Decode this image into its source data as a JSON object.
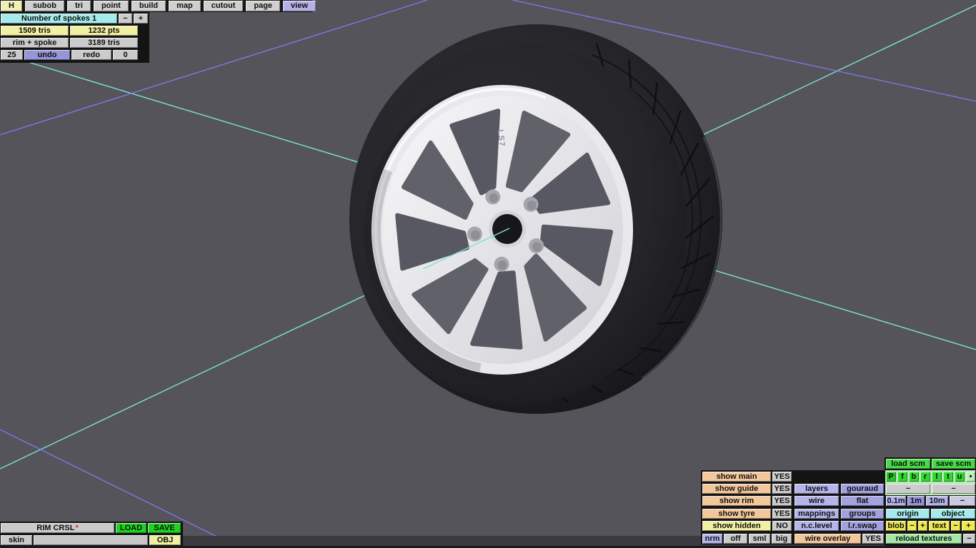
{
  "tabs": [
    "H",
    "subob",
    "tri",
    "point",
    "build",
    "map",
    "cutout",
    "page",
    "view"
  ],
  "top_panel": {
    "spokes": "Number of spokes 1",
    "minus": "−",
    "plus": "+",
    "tris": "1509 tris",
    "pts": "1232 pts",
    "rim_spoke": "rim + spoke",
    "total_tris": "3189 tris",
    "undo_count": "25",
    "undo": "undo",
    "redo": "redo",
    "redo_count": "0"
  },
  "bottom_left": {
    "rim_crsl": "RIM CRSL",
    "star": "*",
    "load": "LOAD",
    "save": "SAVE",
    "skin": "skin",
    "field": "",
    "obj": "OBJ"
  },
  "br": {
    "load_scm": "load scm",
    "save_scm": "save scm",
    "p": "P",
    "f": "f",
    "b": "b",
    "r": "r",
    "l": "l",
    "t": "t",
    "u": "u",
    "dot": "•",
    "dash": "−",
    "plus": "+",
    "show_main": "show main",
    "show_guide": "show guide",
    "show_rim": "show rim",
    "show_tyre": "show tyre",
    "show_hidden": "show hidden",
    "yes": "YES",
    "no": "NO",
    "layers": "layers",
    "gouraud": "gouraud",
    "wire": "wire",
    "flat": "flat",
    "mappings": "mappings",
    "groups": "groups",
    "nclevel": "n.c.level",
    "lrswap": "l.r.swap",
    "m01": "0.1m",
    "m1": "1m",
    "m10": "10m",
    "origin": "origin",
    "object": "object",
    "blob": "blob",
    "text": "text",
    "nrm": "nrm",
    "off": "off",
    "sml": "sml",
    "big": "big",
    "wire_overlay": "wire overlay",
    "reload": "reload textures"
  },
  "wheel": {
    "logo": "LS7"
  },
  "colors": {
    "viewport_bg": "#54545a",
    "guide_cyan": "#7ce0d8",
    "guide_purple": "#7a7ae4",
    "button_green": "#1ed41e",
    "accent_lavender": "#b5b5ec",
    "accent_peach": "#f2c79c",
    "accent_yellow": "#eeea4e",
    "accent_cyan_cell": "#a5ebeb"
  }
}
